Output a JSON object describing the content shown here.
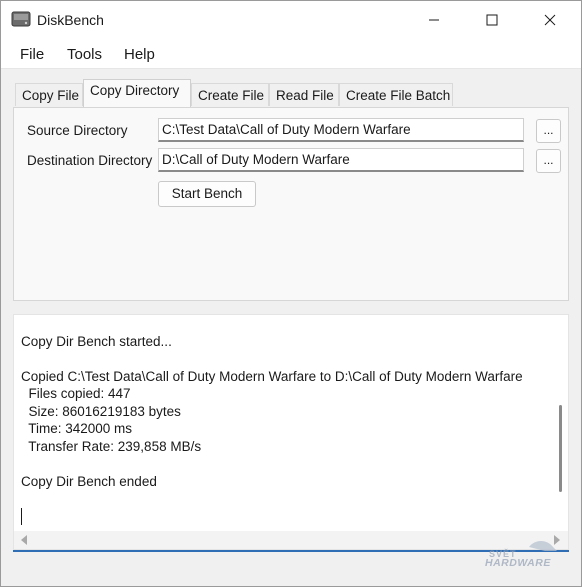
{
  "window": {
    "title": "DiskBench",
    "icon": "disk-drive-icon"
  },
  "menu": {
    "file": "File",
    "tools": "Tools",
    "help": "Help"
  },
  "tabs": [
    {
      "label": "Copy File",
      "active": false
    },
    {
      "label": "Copy Directory",
      "active": true
    },
    {
      "label": "Create File",
      "active": false
    },
    {
      "label": "Read File",
      "active": false
    },
    {
      "label": "Create File Batch",
      "active": false
    }
  ],
  "form": {
    "source_label": "Source Directory",
    "source_value": "C:\\Test Data\\Call of Duty Modern Warfare",
    "destination_label": "Destination Directory",
    "destination_value": "D:\\Call of Duty Modern Warfare",
    "browse_label": "...",
    "start_label": "Start Bench"
  },
  "log": {
    "lines": [
      "Copy Dir Bench started...",
      "Copied C:\\Test Data\\Call of Duty Modern Warfare to D:\\Call of Duty Modern Warfare",
      "  Files copied: 447",
      "  Size: 86016219183 bytes",
      "  Time: 342000 ms",
      "  Transfer Rate: 239,858 MB/s",
      "Copy Dir Bench ended"
    ]
  },
  "watermark": {
    "line1": "SVĚT",
    "line2": "HARDWARE"
  },
  "colors": {
    "accent_line": "#2f6db4",
    "window_bg": "#f0f0f0"
  }
}
